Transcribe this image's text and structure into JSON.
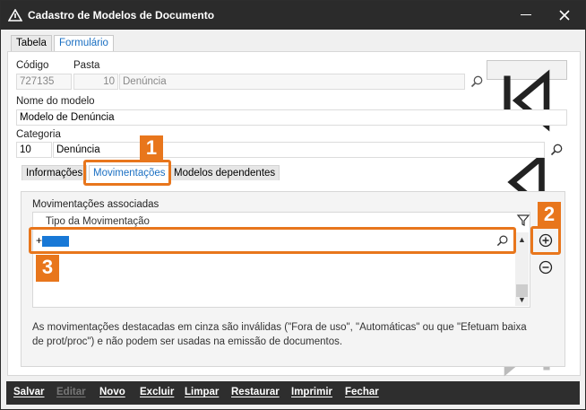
{
  "window": {
    "title": "Cadastro de Modelos de Documento"
  },
  "tabs": [
    {
      "label": "Tabela"
    },
    {
      "label": "Formulário"
    }
  ],
  "form": {
    "codigo_label": "Código",
    "codigo_value": "727135",
    "pasta_label": "Pasta",
    "pasta_code": "10",
    "pasta_name": "Denúncia",
    "nome_label": "Nome do modelo",
    "nome_value": "Modelo de Denúncia",
    "categoria_label": "Categoria",
    "categoria_code": "10",
    "categoria_name": "Denúncia"
  },
  "subtabs": [
    {
      "label": "Informações"
    },
    {
      "label": "Movimentações"
    },
    {
      "label": "Modelos dependentes"
    }
  ],
  "movimentacoes": {
    "group_label": "Movimentações associadas",
    "column_header": "Tipo da Movimentação",
    "row_prefix": "+",
    "note": "As movimentações destacadas em cinza são inválidas (\"Fora de uso\", \"Automáticas\" ou que \"Efetuam baixa de prot/proc\") e não podem ser usadas na emissão de documentos."
  },
  "callouts": [
    {
      "number": "1"
    },
    {
      "number": "2"
    },
    {
      "number": "3"
    }
  ],
  "toolbar": {
    "salvar": "Salvar",
    "editar": "Editar",
    "novo": "Novo",
    "excluir": "Excluir",
    "limpar": "Limpar",
    "restaurar": "Restaurar",
    "imprimir": "Imprimir",
    "fechar": "Fechar"
  },
  "colors": {
    "accent": "#1a6fc2",
    "callout": "#e8761c",
    "selection": "#1878d6",
    "titlebar": "#2b2b2b"
  },
  "icons": {
    "search": "search-icon",
    "first": "first-record-icon",
    "prev": "prev-record-icon",
    "next": "next-record-icon",
    "last": "last-record-icon",
    "filter": "filter-icon",
    "add": "add-circle-icon",
    "remove": "remove-circle-icon"
  }
}
